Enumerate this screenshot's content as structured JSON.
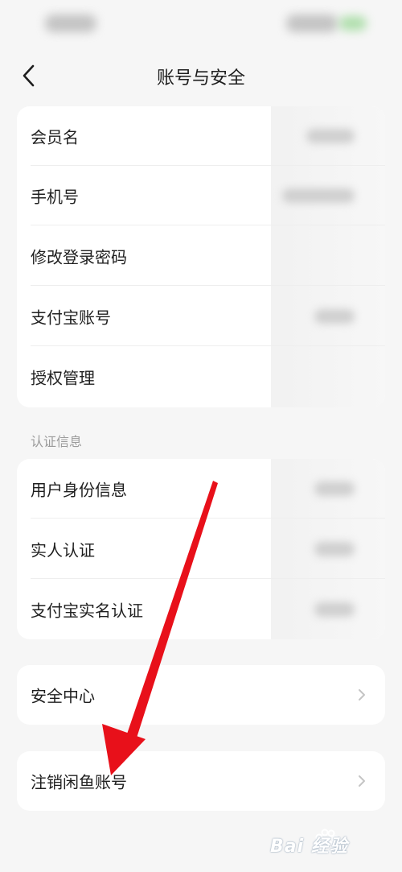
{
  "header": {
    "title": "账号与安全"
  },
  "account_card": {
    "items": [
      {
        "label": "会员名"
      },
      {
        "label": "手机号"
      },
      {
        "label": "修改登录密码"
      },
      {
        "label": "支付宝账号"
      },
      {
        "label": "授权管理"
      }
    ]
  },
  "verification": {
    "section_title": "认证信息",
    "items": [
      {
        "label": "用户身份信息"
      },
      {
        "label": "实人认证"
      },
      {
        "label": "支付宝实名认证"
      }
    ]
  },
  "security_center": {
    "label": "安全中心"
  },
  "deactivate": {
    "label": "注销闲鱼账号"
  },
  "watermark": {
    "text": "Bai 经验"
  },
  "colors": {
    "accent_red": "#e8101a",
    "background": "#f6f6f6",
    "card": "#ffffff"
  },
  "icons": {
    "back": "chevron-left-icon",
    "row_arrow": "chevron-right-icon"
  }
}
